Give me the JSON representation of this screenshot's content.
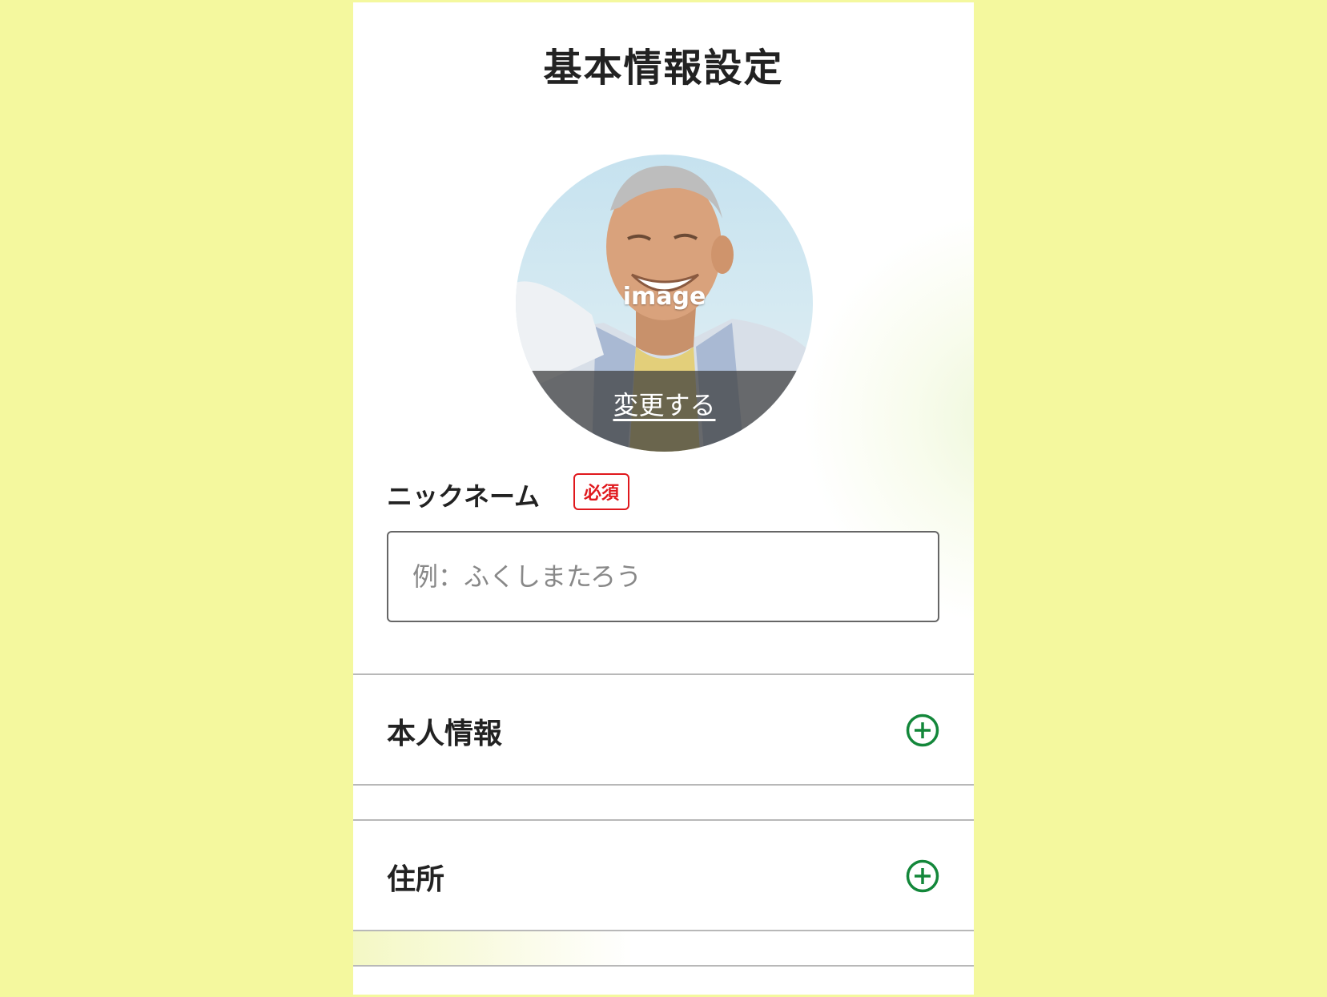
{
  "page": {
    "title": "基本情報設定"
  },
  "avatar": {
    "image_label": "image",
    "change_label": "変更する"
  },
  "nickname": {
    "label": "ニックネーム",
    "required_badge": "必須",
    "placeholder": "例：ふくしまたろう",
    "value": ""
  },
  "sections": [
    {
      "title": "本人情報",
      "icon": "plus-circle-icon"
    },
    {
      "title": "住所",
      "icon": "plus-circle-icon"
    }
  ],
  "colors": {
    "background": "#f4f89e",
    "accent_green": "#13873a",
    "required_red": "#e0181d"
  }
}
